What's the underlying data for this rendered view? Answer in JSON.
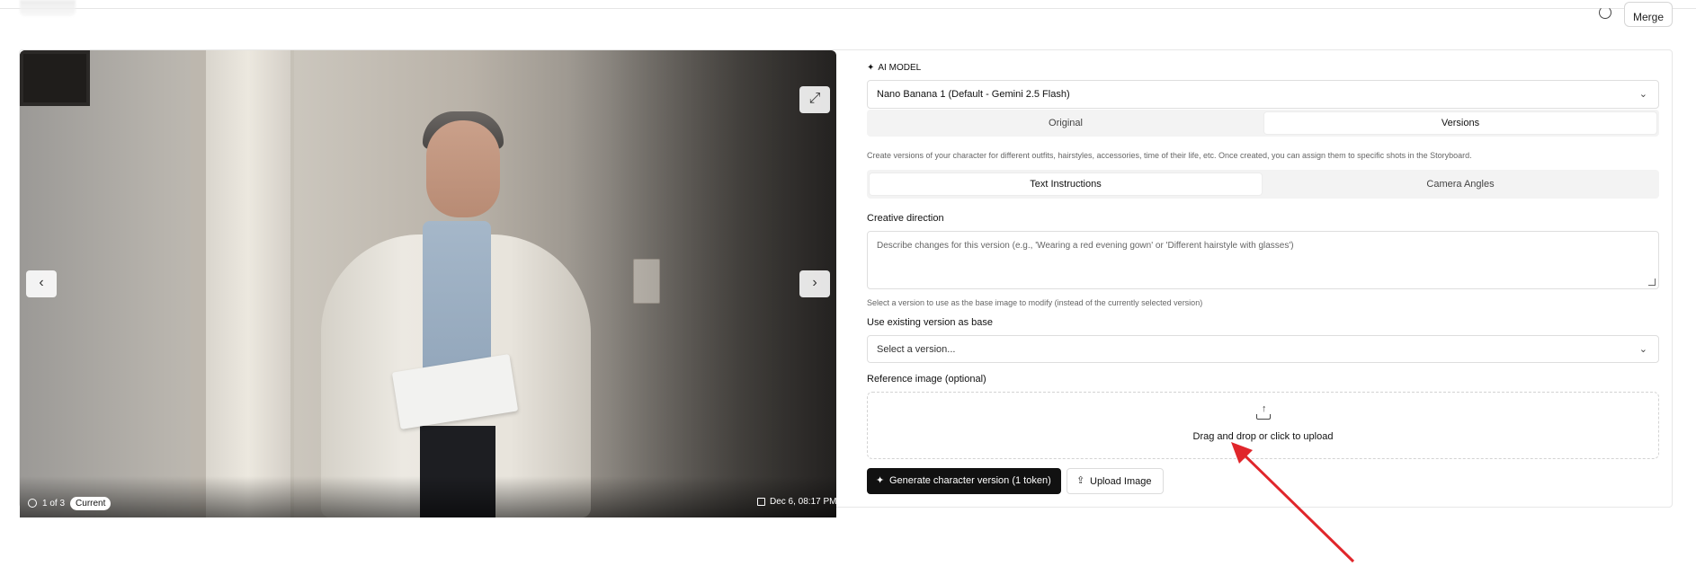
{
  "topbar": {
    "merge_label": "Merge"
  },
  "image_viewer": {
    "counter": "1 of 3",
    "badge": "Current",
    "timestamp": "Dec 6, 08:17 PM",
    "icons": {
      "expand": "expand-icon",
      "prev": "chevron-left-icon",
      "next": "chevron-right-icon",
      "history": "history-icon",
      "calendar": "calendar-icon"
    }
  },
  "form": {
    "ai_model_label": "AI MODEL",
    "ai_model_value": "Nano Banana 1 (Default - Gemini 2.5 Flash)",
    "mode_tabs": [
      {
        "label": "Original",
        "active": false
      },
      {
        "label": "Versions",
        "active": true
      }
    ],
    "description": "Create versions of your character for different outfits, hairstyles, accessories, time of their life, etc. Once created, you can assign them to specific shots in the Storyboard.",
    "input_tabs": [
      {
        "label": "Text Instructions",
        "active": true
      },
      {
        "label": "Camera Angles",
        "active": false
      }
    ],
    "creative_direction_label": "Creative direction",
    "creative_direction_placeholder": "Describe changes for this version (e.g., 'Wearing a red evening gown' or 'Different hairstyle with glasses')",
    "base_hint": "Select a version to use as the base image to modify (instead of the currently selected version)",
    "base_label": "Use existing version as base",
    "base_placeholder": "Select a version...",
    "reference_label": "Reference image (optional)",
    "drop_text": "Drag and drop or click to upload",
    "generate_label": "Generate character version (1 token)",
    "upload_label": "Upload Image"
  },
  "colors": {
    "primary_button": "#111111",
    "annotation_arrow": "#e0262b"
  }
}
